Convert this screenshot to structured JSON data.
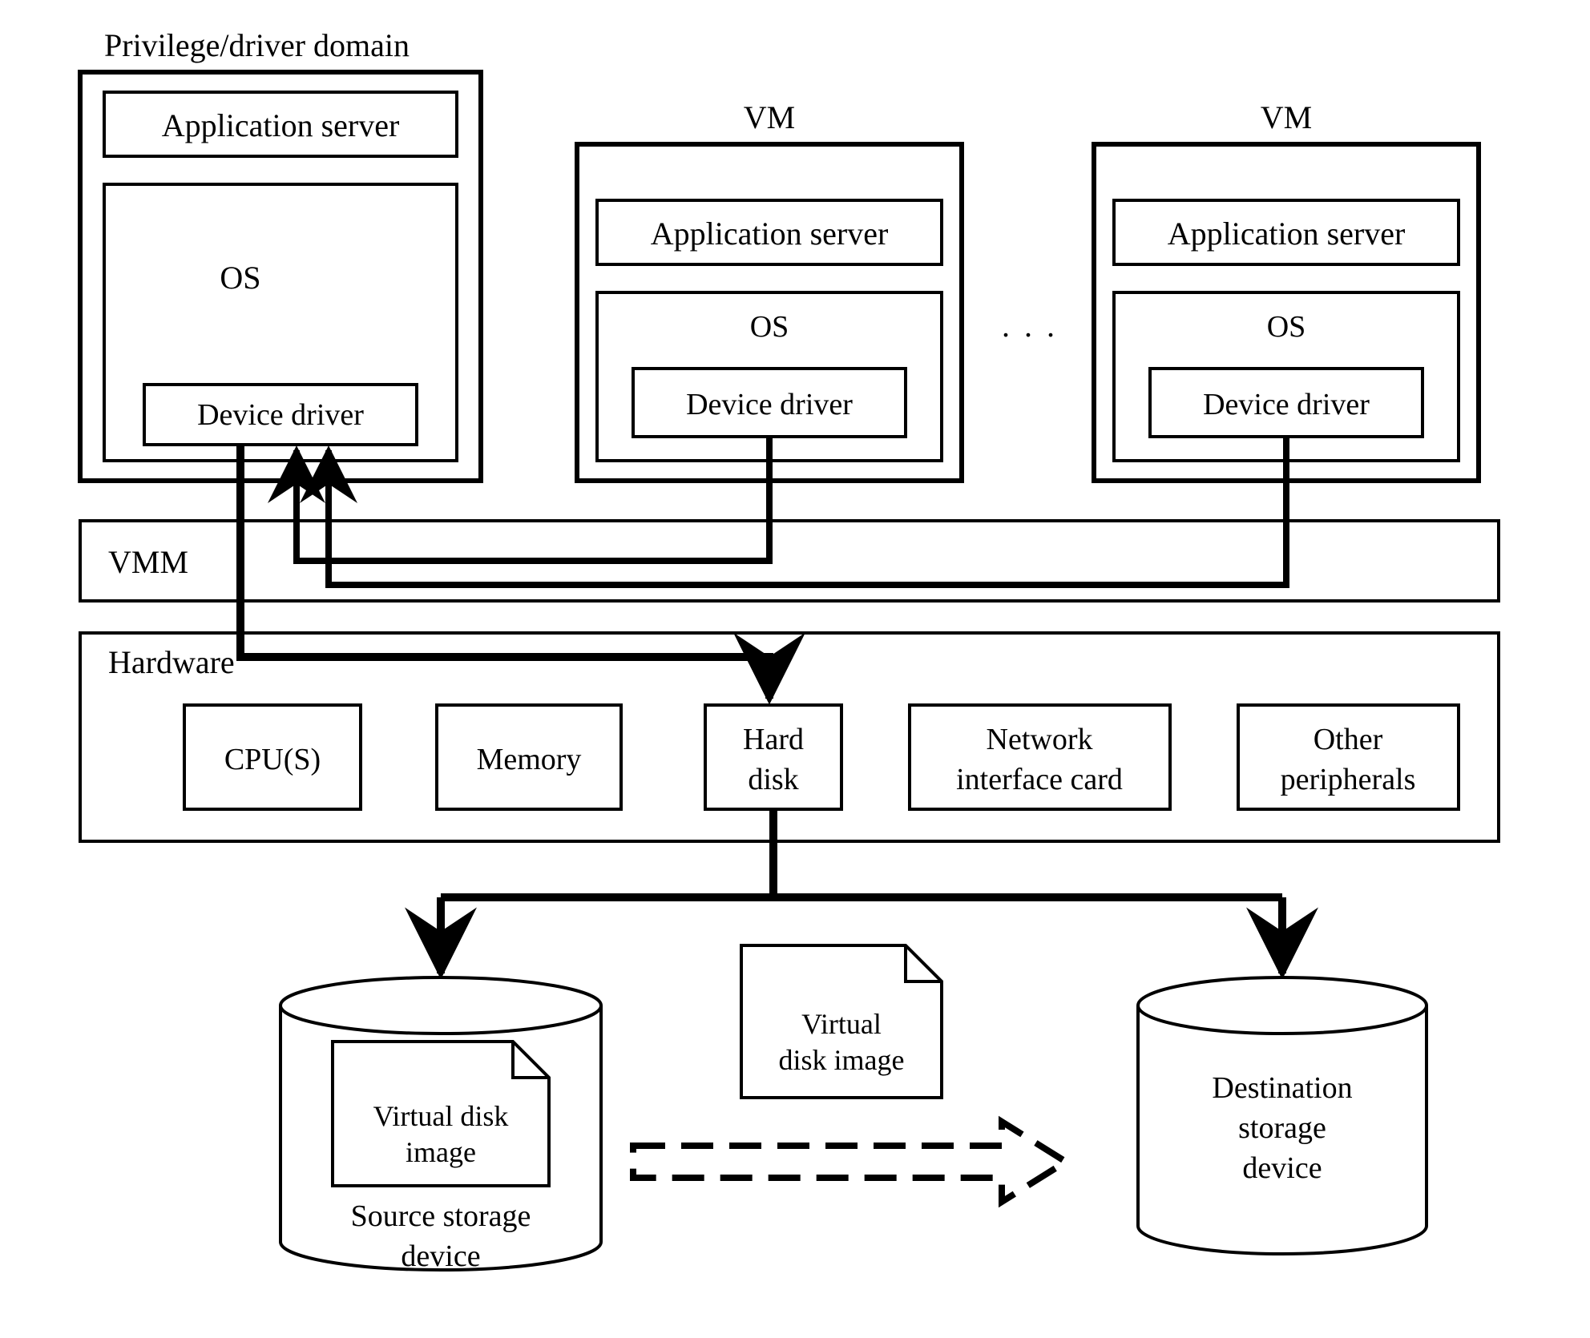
{
  "privilege_domain": {
    "title": "Privilege/driver domain",
    "app_server": "Application server",
    "os_label": "OS",
    "device_driver": "Device driver"
  },
  "vm1": {
    "title": "VM",
    "app_server": "Application server",
    "os_label": "OS",
    "device_driver": "Device driver"
  },
  "vm_ellipsis": ". . .",
  "vm2": {
    "title": "VM",
    "app_server": "Application server",
    "os_label": "OS",
    "device_driver": "Device driver"
  },
  "vmm_label": "VMM",
  "hardware": {
    "title": "Hardware",
    "cpu": "CPU(S)",
    "memory": "Memory",
    "hard_disk_line1": "Hard",
    "hard_disk_line2": "disk",
    "nic_line1": "Network",
    "nic_line2": "interface card",
    "other_line1": "Other",
    "other_line2": "peripherals"
  },
  "source_storage": {
    "vdi_line1": "Virtual disk",
    "vdi_line2": "image",
    "label_line1": "Source storage",
    "label_line2": "device"
  },
  "middle_vdi": {
    "vdi_line1": "Virtual",
    "vdi_line2": "disk image"
  },
  "dest_storage": {
    "label_line1": "Destination",
    "label_line2": "storage",
    "label_line3": "device"
  }
}
